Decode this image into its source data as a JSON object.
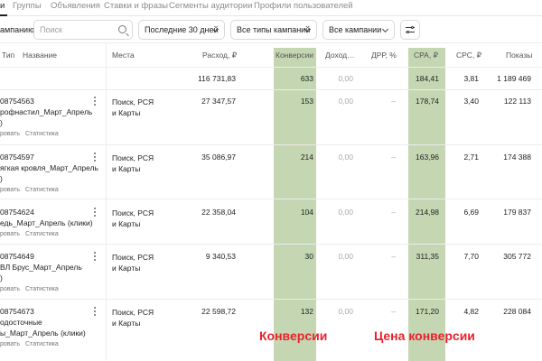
{
  "tabs": [
    {
      "label": "и",
      "active": true
    },
    {
      "label": "Группы"
    },
    {
      "label": "Объявления"
    },
    {
      "label": "Ставки и фразы"
    },
    {
      "label": "Сегменты аудитории"
    },
    {
      "label": "Профили пользователей"
    }
  ],
  "toolbar": {
    "campaign_label": "ампанию",
    "search_placeholder": "Поиск",
    "period": "Последние 30 дней",
    "campaign_types": "Все типы кампаний",
    "campaigns": "Все кампании"
  },
  "columns": [
    "Тип",
    "Название",
    "Места",
    "Расход, ₽",
    "Конверсии",
    "Доход…",
    "ДРР, %",
    "CPA, ₽",
    "CPC, ₽",
    "Показы"
  ],
  "totals": {
    "spend": "116 731,83",
    "conversions": "633",
    "revenue": "0,00",
    "cpa": "184,41",
    "cpc": "3,81",
    "impressions": "1 189 469"
  },
  "rows": [
    {
      "id": "08754563",
      "name": [
        "рофнастил_Март_Апрель",
        ")"
      ],
      "places": [
        "Поиск, РСЯ",
        "и Карты"
      ],
      "spend": "27 347,57",
      "conversions": "153",
      "revenue": "0,00",
      "drr": "–",
      "cpa": "178,74",
      "cpc": "3,40",
      "impressions": "122 113"
    },
    {
      "id": "08754597",
      "name": [
        "ягкая кровля_Март_Апрель",
        ")"
      ],
      "places": [
        "Поиск, РСЯ",
        "и Карты"
      ],
      "spend": "35 086,97",
      "conversions": "214",
      "revenue": "0,00",
      "drr": "–",
      "cpa": "163,96",
      "cpc": "2,71",
      "impressions": "174 388"
    },
    {
      "id": "08754624",
      "name": [
        "едь_Март_Апрель (клики)"
      ],
      "places": [
        "Поиск, РСЯ",
        "и Карты"
      ],
      "spend": "22 358,04",
      "conversions": "104",
      "revenue": "0,00",
      "drr": "–",
      "cpa": "214,98",
      "cpc": "6,69",
      "impressions": "179 837"
    },
    {
      "id": "08754649",
      "name": [
        "ВЛ Брус_Март_Апрель",
        ")"
      ],
      "places": [
        "Поиск, РСЯ",
        "и Карты"
      ],
      "spend": "9 340,53",
      "conversions": "30",
      "revenue": "0,00",
      "drr": "–",
      "cpa": "311,35",
      "cpc": "7,70",
      "impressions": "305 772"
    },
    {
      "id": "08754673",
      "name": [
        "одосточные",
        "ы_Март_Апрель (клики)"
      ],
      "places": [
        "Поиск, РСЯ",
        "и Карты"
      ],
      "spend": "22 598,72",
      "conversions": "132",
      "revenue": "0,00",
      "drr": "–",
      "cpa": "171,20",
      "cpc": "4,82",
      "impressions": "228 084"
    }
  ],
  "row_actions": {
    "edit": "ровать",
    "stats": "Статистика"
  },
  "annotations": {
    "conversions": "Конверсии",
    "cpa": "Цена конверсии"
  },
  "colors": {
    "highlight": "#c5d6b2",
    "annotation": "#e8222d"
  }
}
